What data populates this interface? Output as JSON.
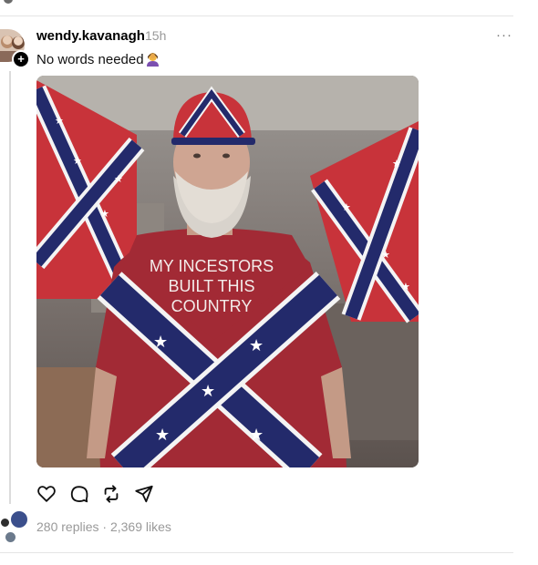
{
  "post": {
    "username": "wendy.kavanagh",
    "timestamp": "15h",
    "text": "No words needed",
    "more_icon": "···",
    "follow_icon": "+"
  },
  "image": {
    "shirt_text_line1": "MY INCESTORS",
    "shirt_text_line2": "BUILT THIS",
    "shirt_text_line3": "COUNTRY"
  },
  "stats": {
    "replies": "280 replies",
    "separator": "·",
    "likes": "2,369 likes"
  },
  "icons": {
    "like": "heart-icon",
    "reply": "comment-icon",
    "repost": "repost-icon",
    "share": "send-icon"
  },
  "colors": {
    "divider": "#e5e5e5",
    "muted_text": "#999999",
    "flag_red": "#c8333a",
    "flag_blue": "#232a6b"
  }
}
